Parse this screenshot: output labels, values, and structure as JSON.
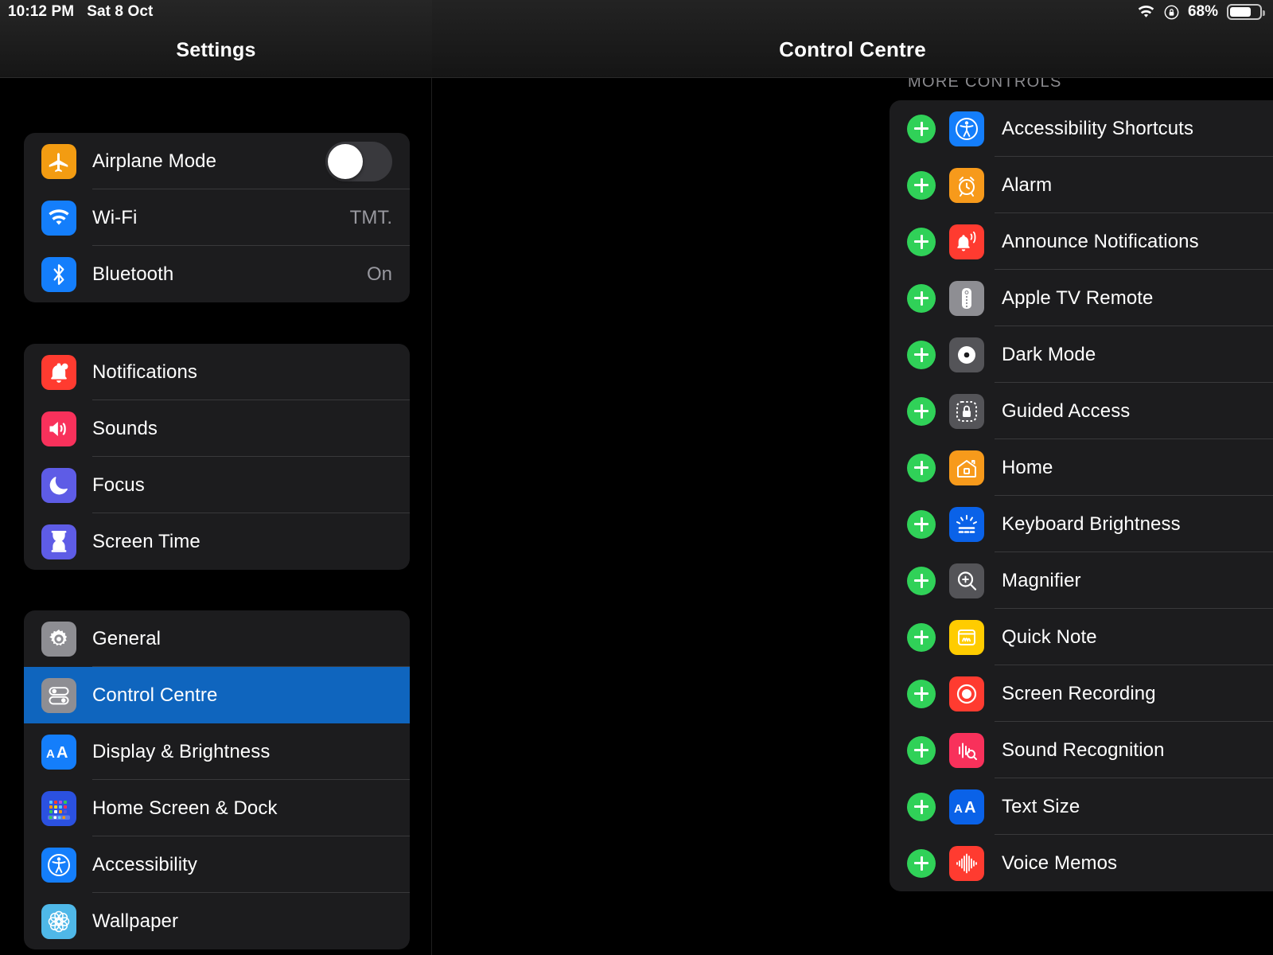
{
  "statusbar": {
    "time": "10:12 PM",
    "date": "Sat 8 Oct",
    "battery_percent": "68%",
    "wifi_icon": "wifi-icon",
    "rotation_lock_icon": "rotation-lock-icon",
    "battery_icon": "battery-icon"
  },
  "sidebar": {
    "title": "Settings",
    "groups": [
      {
        "items": [
          {
            "label": "Airplane Mode",
            "icon": "airplane-icon",
            "control": "toggle",
            "toggle_on": false
          },
          {
            "label": "Wi-Fi",
            "icon": "wifi-icon",
            "value": "TMT."
          },
          {
            "label": "Bluetooth",
            "icon": "bluetooth-icon",
            "value": "On"
          }
        ]
      },
      {
        "items": [
          {
            "label": "Notifications",
            "icon": "bell-icon"
          },
          {
            "label": "Sounds",
            "icon": "speaker-icon"
          },
          {
            "label": "Focus",
            "icon": "moon-icon"
          },
          {
            "label": "Screen Time",
            "icon": "hourglass-icon"
          }
        ]
      },
      {
        "items": [
          {
            "label": "General",
            "icon": "gear-icon"
          },
          {
            "label": "Control Centre",
            "icon": "sliders-icon",
            "selected": true
          },
          {
            "label": "Display & Brightness",
            "icon": "text-size-icon"
          },
          {
            "label": "Home Screen & Dock",
            "icon": "home-screen-grid-icon"
          },
          {
            "label": "Accessibility",
            "icon": "accessibility-icon"
          },
          {
            "label": "Wallpaper",
            "icon": "wallpaper-flower-icon"
          }
        ]
      }
    ]
  },
  "main": {
    "title": "Control Centre",
    "section_header": "MORE CONTROLS",
    "add_icon": "plus-icon",
    "controls": [
      {
        "label": "Accessibility Shortcuts",
        "icon": "accessibility-icon"
      },
      {
        "label": "Alarm",
        "icon": "alarm-clock-icon"
      },
      {
        "label": "Announce Notifications",
        "icon": "announce-bell-icon"
      },
      {
        "label": "Apple TV Remote",
        "icon": "tv-remote-icon"
      },
      {
        "label": "Dark Mode",
        "icon": "dark-mode-icon"
      },
      {
        "label": "Guided Access",
        "icon": "guided-access-lock-icon"
      },
      {
        "label": "Home",
        "icon": "home-house-icon"
      },
      {
        "label": "Keyboard Brightness",
        "icon": "keyboard-brightness-icon"
      },
      {
        "label": "Magnifier",
        "icon": "magnifier-icon"
      },
      {
        "label": "Quick Note",
        "icon": "quick-note-icon"
      },
      {
        "label": "Screen Recording",
        "icon": "screen-recording-icon"
      },
      {
        "label": "Sound Recognition",
        "icon": "sound-recognition-icon"
      },
      {
        "label": "Text Size",
        "icon": "text-size-icon"
      },
      {
        "label": "Voice Memos",
        "icon": "voice-memos-icon"
      }
    ]
  },
  "colors": {
    "selection_blue": "#0F65BE",
    "add_green": "#30D158",
    "card_bg": "#1C1C1E",
    "background": "#000000",
    "secondary_text": "#98989F"
  }
}
